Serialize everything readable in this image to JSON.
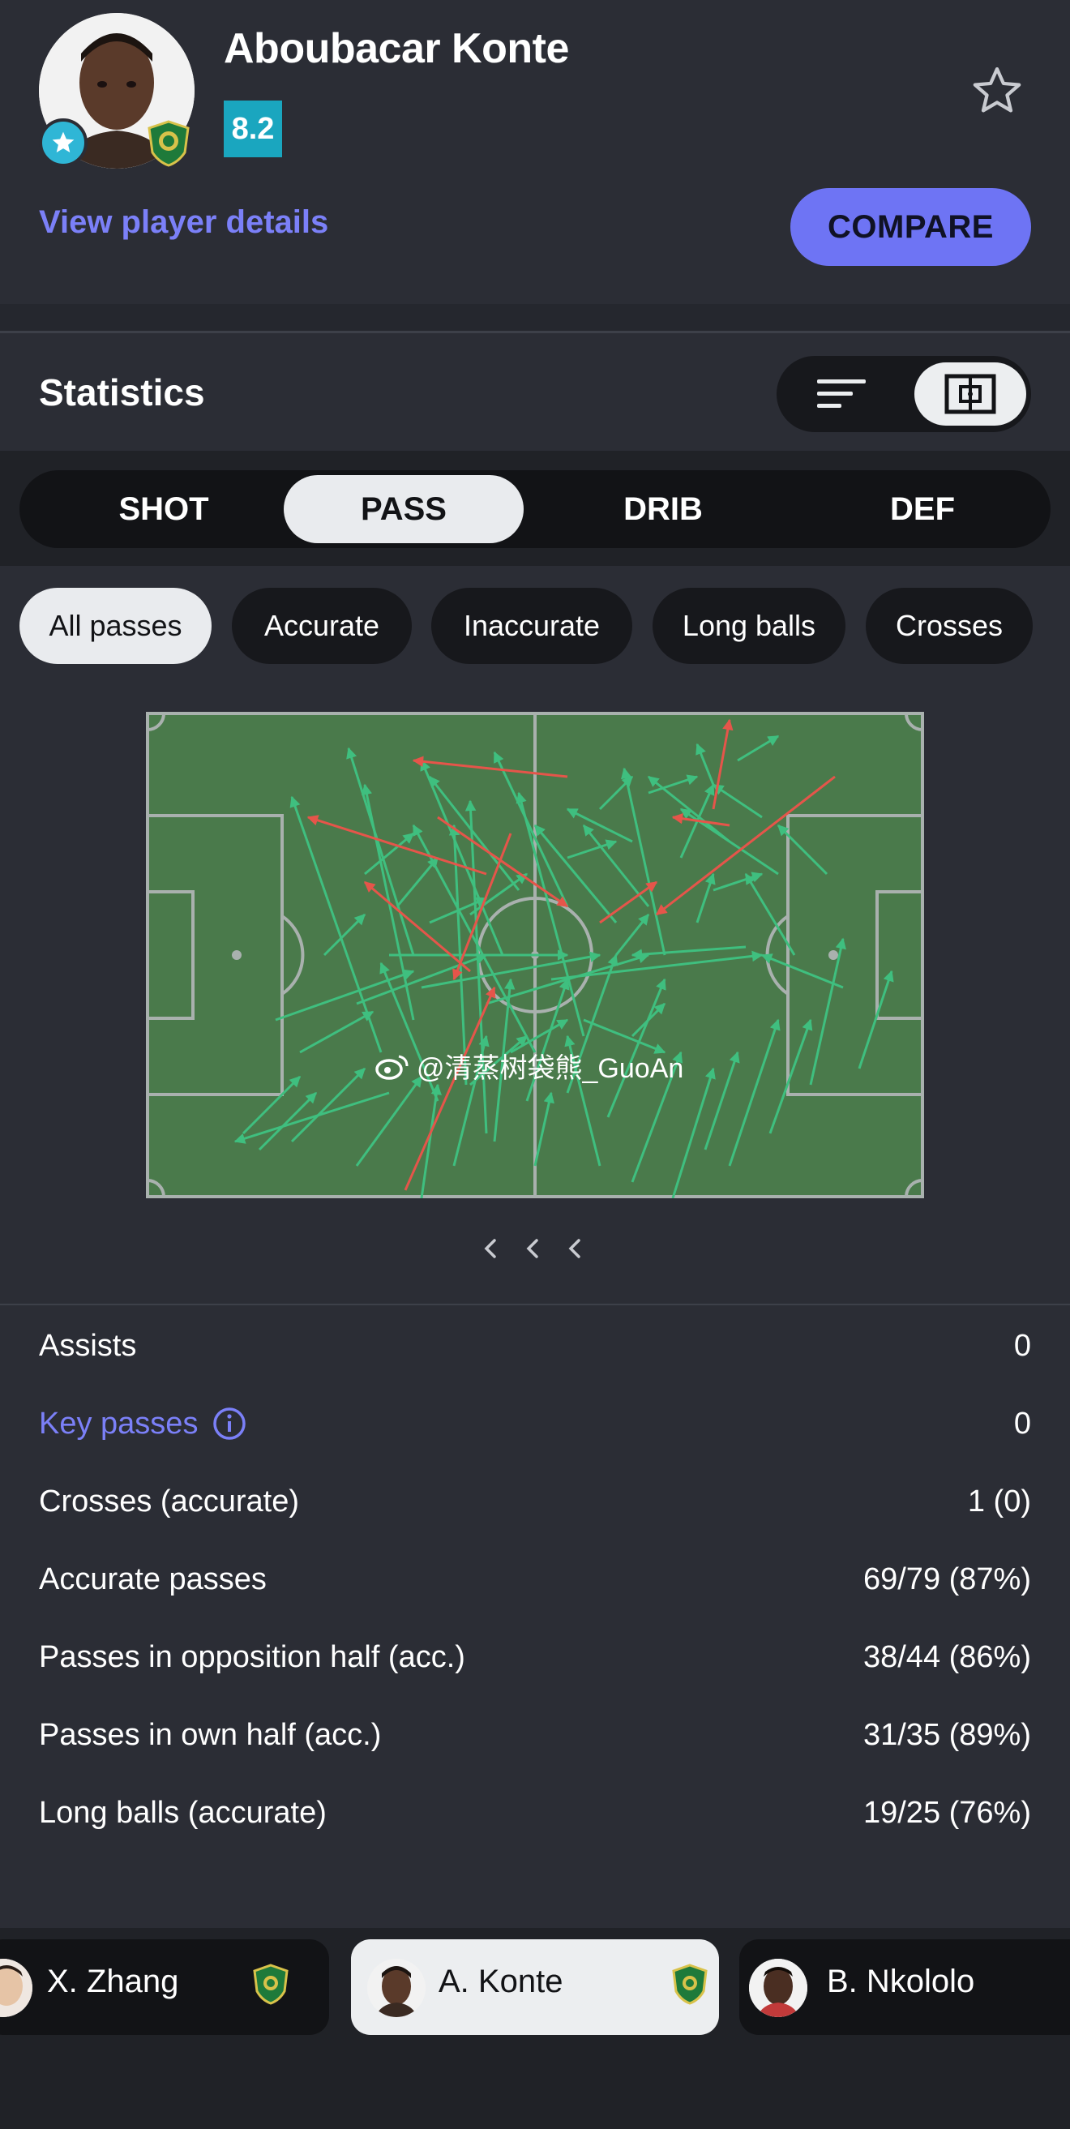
{
  "player": {
    "name": "Aboubacar Konte",
    "rating": "8.2",
    "view_details_label": "View player details",
    "compare_label": "COMPARE"
  },
  "statistics": {
    "title": "Statistics"
  },
  "tabs": [
    {
      "label": "SHOT",
      "active": false
    },
    {
      "label": "PASS",
      "active": true
    },
    {
      "label": "DRIB",
      "active": false
    },
    {
      "label": "DEF",
      "active": false
    }
  ],
  "filters": [
    {
      "label": "All passes",
      "active": true
    },
    {
      "label": "Accurate",
      "active": false
    },
    {
      "label": "Inaccurate",
      "active": false
    },
    {
      "label": "Long balls",
      "active": false
    },
    {
      "label": "Crosses",
      "active": false
    }
  ],
  "watermark": "@清蒸树袋熊_GuoAn",
  "colors": {
    "accent": "#6e74f4",
    "rating_bg": "#1aa6bf",
    "pitch": "#4a7a4b",
    "accurate_pass": "#3fbf7f",
    "inaccurate_pass": "#e5554a"
  },
  "stats": [
    {
      "label": "Assists",
      "value": "0"
    },
    {
      "label": "Key passes",
      "value": "0",
      "link": true
    },
    {
      "label": "Crosses (accurate)",
      "value": "1 (0)"
    },
    {
      "label": "Accurate passes",
      "value": "69/79 (87%)"
    },
    {
      "label": "Passes in opposition half (acc.)",
      "value": "38/44 (86%)"
    },
    {
      "label": "Passes in own half (acc.)",
      "value": "31/35 (89%)"
    },
    {
      "label": "Long balls (accurate)",
      "value": "19/25 (76%)"
    }
  ],
  "players_bar": [
    {
      "name": "X. Zhang",
      "active": false
    },
    {
      "name": "A. Konte",
      "active": true
    },
    {
      "name": "B. Nkololo",
      "active": false
    }
  ]
}
